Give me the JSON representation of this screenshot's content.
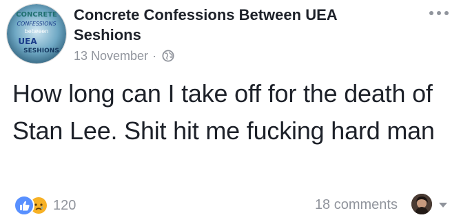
{
  "post": {
    "page_name": "Concrete Confessions Between UEA Seshions",
    "timestamp": "13 November",
    "separator": "·",
    "privacy_icon": "globe-icon",
    "text": "How long can I take off for the death of Stan Lee. Shit hit me fucking hard man",
    "avatar_text": {
      "line1": "CONCRETE",
      "line2": "CONFESSIONS",
      "line3": "between",
      "line4": "UEA",
      "line5": "SESHIONS"
    }
  },
  "footer": {
    "reaction_icons": [
      "like-icon",
      "sad-icon"
    ],
    "reaction_count": "120",
    "comments_label": "18 comments"
  },
  "colors": {
    "text": "#1d2129",
    "meta": "#90949c",
    "like": "#5890ff",
    "sad": "#f7b125"
  }
}
